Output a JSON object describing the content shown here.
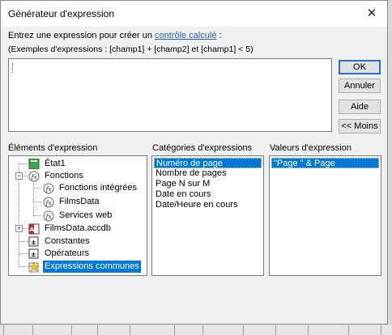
{
  "dialog": {
    "title": "Générateur d'expression",
    "prompt_prefix": "Entrez une expression pour créer un ",
    "prompt_link": "contrôle calculé",
    "prompt_suffix": " :",
    "examples": "(Exemples d'expressions : [champ1] + [champ2] et [champ1] < 5)",
    "expression_value": ""
  },
  "buttons": {
    "ok": "OK",
    "cancel": "Annuler",
    "help": "Aide",
    "less": "<< Moins"
  },
  "columns": {
    "elements": "Éléments d'expression",
    "categories": "Catégories d'expressions",
    "values": "Valeurs d'expression"
  },
  "elements": [
    {
      "label": "État1",
      "icon": "report-icon"
    },
    {
      "label": "Fonctions",
      "icon": "function-icon",
      "expander": "−"
    },
    {
      "label": "Fonctions intégrées",
      "icon": "function-icon"
    },
    {
      "label": "FilmsData",
      "icon": "function-icon"
    },
    {
      "label": "Services web",
      "icon": "function-icon"
    },
    {
      "label": "FilmsData.accdb",
      "icon": "database-icon",
      "expander": "+"
    },
    {
      "label": "Constantes",
      "icon": "constants-icon"
    },
    {
      "label": "Opérateurs",
      "icon": "operators-icon"
    },
    {
      "label": "Expressions communes",
      "icon": "common-expressions-icon",
      "selected": true
    }
  ],
  "categories": [
    {
      "label": "Numéro de page",
      "selected": true
    },
    {
      "label": "Nombre de pages"
    },
    {
      "label": "Page N sur M"
    },
    {
      "label": "Date en cours"
    },
    {
      "label": "Date/Heure en cours"
    }
  ],
  "values": [
    {
      "label": "\"Page \" & Page",
      "selected": true
    }
  ],
  "colors": {
    "accent": "#0078d7",
    "link": "#1f5fbf",
    "ok_border": "#2a6fd6"
  }
}
